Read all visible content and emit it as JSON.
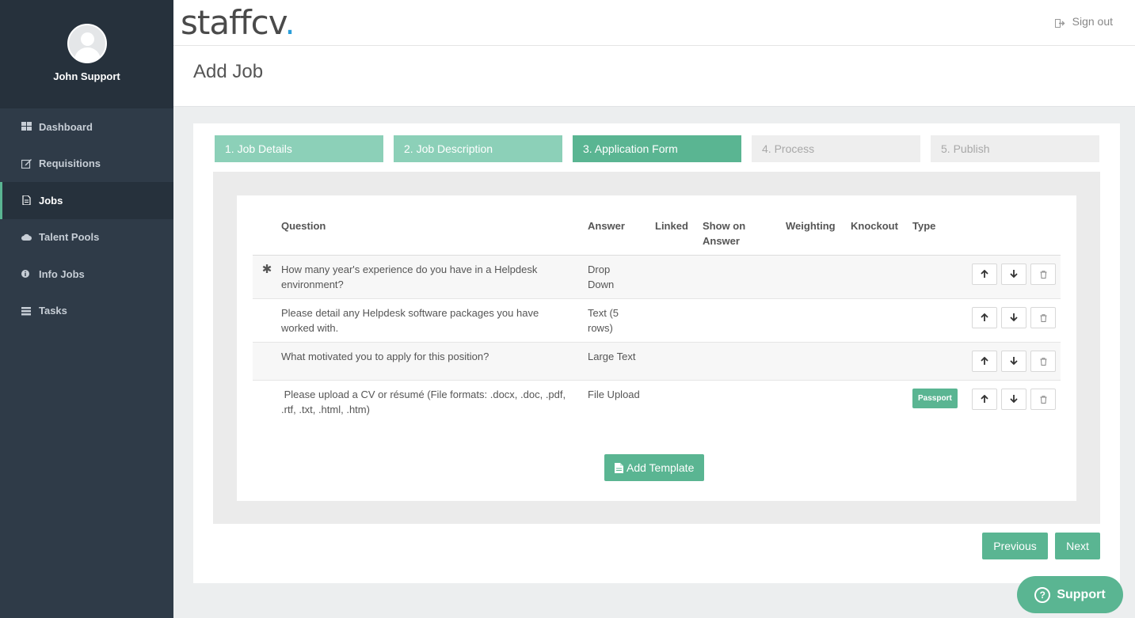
{
  "user": {
    "name": "John Support"
  },
  "sidebar": {
    "items": [
      {
        "label": "Dashboard",
        "icon": "dashboard-icon"
      },
      {
        "label": "Requisitions",
        "icon": "edit-icon"
      },
      {
        "label": "Jobs",
        "icon": "document-icon",
        "active": true
      },
      {
        "label": "Talent Pools",
        "icon": "cloud-icon"
      },
      {
        "label": "Info Jobs",
        "icon": "info-icon"
      },
      {
        "label": "Tasks",
        "icon": "tasks-icon"
      }
    ]
  },
  "topbar": {
    "logo": "staffcv",
    "logo_dot": ".",
    "signout": "Sign out"
  },
  "page": {
    "title": "Add Job"
  },
  "steps": [
    {
      "label": "1. Job Details",
      "state": "done"
    },
    {
      "label": "2. Job Description",
      "state": "done"
    },
    {
      "label": "3. Application Form",
      "state": "current"
    },
    {
      "label": "4. Process",
      "state": "todo"
    },
    {
      "label": "5. Publish",
      "state": "todo"
    }
  ],
  "table": {
    "headers": {
      "question": "Question",
      "answer": "Answer",
      "linked": "Linked",
      "show_on_answer": "Show on Answer",
      "weighting": "Weighting",
      "knockout": "Knockout",
      "type": "Type"
    },
    "rows": [
      {
        "required": "✱",
        "question": "How many year's experience do you have in a Helpdesk environment?",
        "answer": "Drop Down",
        "type": ""
      },
      {
        "required": "",
        "question": "Please detail any Helpdesk software packages you have worked with.",
        "answer": "Text (5 rows)",
        "type": ""
      },
      {
        "required": "",
        "question": "What motivated you to apply for this position?",
        "answer": "Large Text",
        "type": ""
      },
      {
        "required": "",
        "question": " Please upload a CV or résumé (File formats: .docx, .doc, .pdf, .rtf, .txt, .html, .htm)",
        "answer": "File Upload",
        "type": "Passport"
      }
    ]
  },
  "actions": {
    "add_template": "Add Template",
    "previous": "Previous",
    "next": "Next",
    "support": "Support"
  },
  "colors": {
    "accent": "#5ab592",
    "accent_light": "#8cd0b8",
    "sidebar": "#2f3b48",
    "sidebar_dark": "#26313c",
    "logo_dot": "#2b9ed9"
  }
}
